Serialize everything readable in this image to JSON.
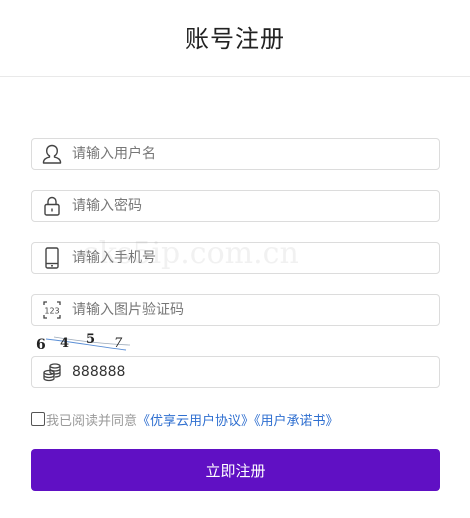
{
  "header": {
    "title": "账号注册"
  },
  "form": {
    "username": {
      "placeholder": "请输入用户名",
      "value": "",
      "icon": "user-icon"
    },
    "password": {
      "placeholder": "请输入密码",
      "value": "",
      "icon": "lock-icon"
    },
    "phone": {
      "placeholder": "请输入手机号",
      "value": "",
      "icon": "phone-icon"
    },
    "image_code": {
      "placeholder": "请输入图片验证码",
      "value": "",
      "icon": "code-123-icon",
      "icon_text": "123"
    },
    "captcha": {
      "digits": [
        "6",
        "4",
        "5",
        "7"
      ]
    },
    "sms_code": {
      "value": "888888",
      "icon": "coins-icon"
    }
  },
  "agreement": {
    "checked": false,
    "text": "我已阅读并同意",
    "link_text": "《优享云用户协议》《用户承诺书》"
  },
  "submit": {
    "label": "立即注册",
    "color": "#6010c4"
  },
  "watermark": {
    "text": "cks5ip.com.cn"
  }
}
